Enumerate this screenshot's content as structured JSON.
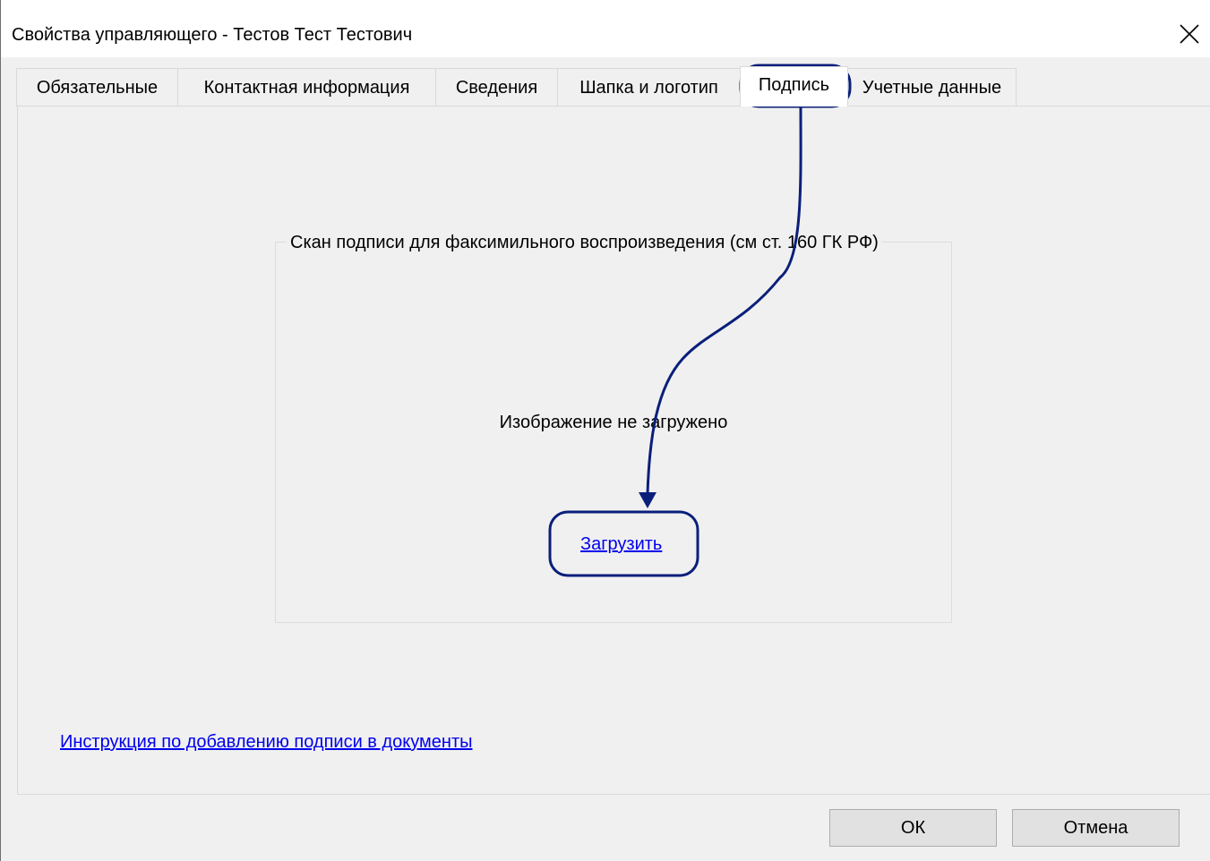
{
  "window": {
    "title": "Свойства управляющего - Тестов Тест Тестович"
  },
  "tabs": [
    {
      "label": "Обязательные"
    },
    {
      "label": "Контактная информация"
    },
    {
      "label": "Сведения"
    },
    {
      "label": "Шапка и логотип"
    },
    {
      "label": "Подпись",
      "active": true
    },
    {
      "label": "Учетные данные"
    }
  ],
  "signature_group": {
    "legend": "Скан подписи для факсимильного воспроизведения (см ст. 160 ГК РФ)",
    "status": "Изображение не загружено",
    "upload_link": "Загрузить"
  },
  "instruction_link": "Инструкция по добавлению подписи в документы",
  "buttons": {
    "ok": "ОК",
    "cancel": "Отмена"
  },
  "colors": {
    "annotation": "#0a1f7a",
    "link": "#0000ee",
    "background": "#f0f0f0"
  },
  "icons": {
    "close": "close-icon"
  }
}
